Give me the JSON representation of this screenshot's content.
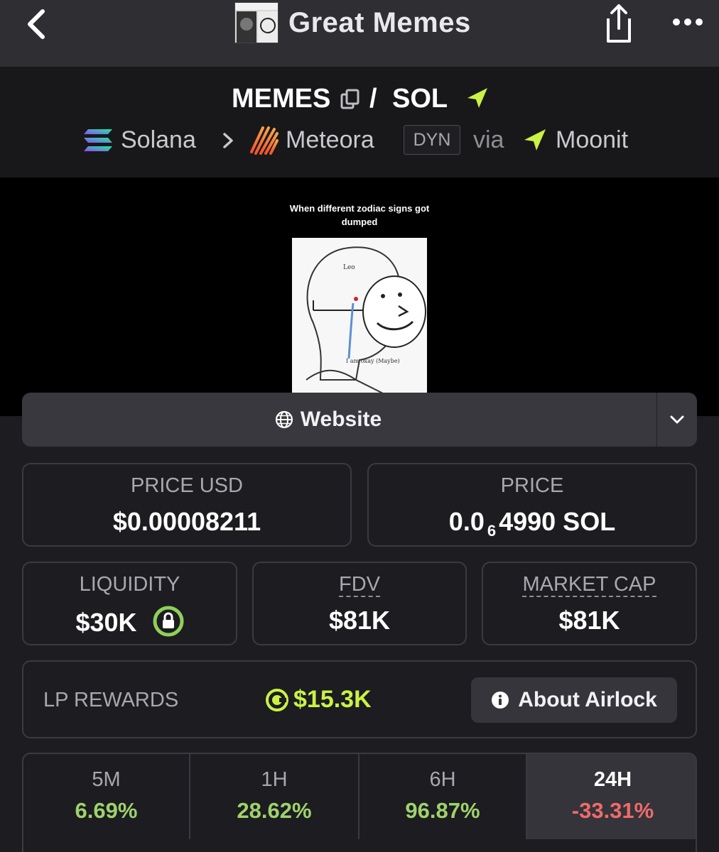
{
  "nav": {
    "title": "Great Memes"
  },
  "pair": {
    "base": "MEMES",
    "separator": "/",
    "quote": "SOL",
    "chain": "Solana",
    "dex": "Meteora",
    "dex_tag": "DYN",
    "via": "via",
    "launchpad": "Moonit"
  },
  "banner": {
    "caption": "When different zodiac signs got dumped",
    "meme_text_top": "Leo",
    "meme_text_bottom": "I am okay (Maybe)"
  },
  "website": {
    "label": "Website"
  },
  "stats": {
    "price_usd_label": "PRICE USD",
    "price_usd": "$0.00008211",
    "price_label": "PRICE",
    "price_sol_prefix": "0.0",
    "price_sol_zeros": "6",
    "price_sol_suffix": "4990 SOL",
    "liquidity_label": "LIQUIDITY",
    "liquidity": "$30K",
    "fdv_label": "FDV",
    "fdv": "$81K",
    "mcap_label": "MARKET CAP",
    "mcap": "$81K"
  },
  "lp": {
    "label": "LP REWARDS",
    "value": "$15.3K",
    "button": "About Airlock"
  },
  "timeframes": [
    {
      "label": "5M",
      "change": "6.69%"
    },
    {
      "label": "1H",
      "change": "28.62%"
    },
    {
      "label": "6H",
      "change": "96.87%"
    },
    {
      "label": "24H",
      "change": "-33.31%"
    }
  ],
  "colors": {
    "accent": "#c9f245",
    "positive": "#9ed26b",
    "negative": "#f06a6a",
    "background": "#1c1c21"
  },
  "icons": [
    "back-chevron-icon",
    "share-icon",
    "more-icon",
    "copy-icon",
    "moonit-icon",
    "solana-icon",
    "chevron-right-icon",
    "meteora-icon",
    "globe-icon",
    "chevron-down-icon",
    "lock-icon",
    "airlock-icon",
    "info-icon"
  ]
}
